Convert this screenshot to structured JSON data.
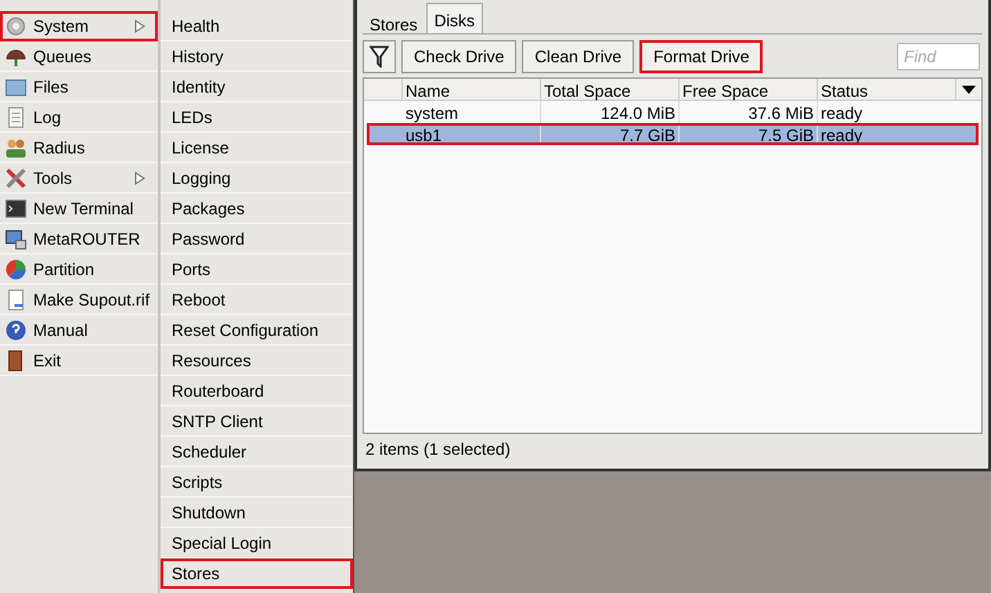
{
  "menu": {
    "items": [
      {
        "label": "System",
        "submenu": true,
        "outlined": true
      },
      {
        "label": "Queues",
        "submenu": false,
        "outlined": false
      },
      {
        "label": "Files",
        "submenu": false,
        "outlined": false
      },
      {
        "label": "Log",
        "submenu": false,
        "outlined": false
      },
      {
        "label": "Radius",
        "submenu": false,
        "outlined": false
      },
      {
        "label": "Tools",
        "submenu": true,
        "outlined": false
      },
      {
        "label": "New Terminal",
        "submenu": false,
        "outlined": false
      },
      {
        "label": "MetaROUTER",
        "submenu": false,
        "outlined": false
      },
      {
        "label": "Partition",
        "submenu": false,
        "outlined": false
      },
      {
        "label": "Make Supout.rif",
        "submenu": false,
        "outlined": false
      },
      {
        "label": "Manual",
        "submenu": false,
        "outlined": false
      },
      {
        "label": "Exit",
        "submenu": false,
        "outlined": false
      }
    ]
  },
  "submenu": {
    "items": [
      {
        "label": "Health",
        "outlined": false
      },
      {
        "label": "History",
        "outlined": false
      },
      {
        "label": "Identity",
        "outlined": false
      },
      {
        "label": "LEDs",
        "outlined": false
      },
      {
        "label": "License",
        "outlined": false
      },
      {
        "label": "Logging",
        "outlined": false
      },
      {
        "label": "Packages",
        "outlined": false
      },
      {
        "label": "Password",
        "outlined": false
      },
      {
        "label": "Ports",
        "outlined": false
      },
      {
        "label": "Reboot",
        "outlined": false
      },
      {
        "label": "Reset Configuration",
        "outlined": false
      },
      {
        "label": "Resources",
        "outlined": false
      },
      {
        "label": "Routerboard",
        "outlined": false
      },
      {
        "label": "SNTP Client",
        "outlined": false
      },
      {
        "label": "Scheduler",
        "outlined": false
      },
      {
        "label": "Scripts",
        "outlined": false
      },
      {
        "label": "Shutdown",
        "outlined": false
      },
      {
        "label": "Special Login",
        "outlined": false
      },
      {
        "label": "Stores",
        "outlined": true
      }
    ]
  },
  "window": {
    "tabs": [
      {
        "label": "Stores",
        "selected": false
      },
      {
        "label": "Disks",
        "selected": true
      }
    ],
    "buttons": [
      {
        "label": "Check Drive",
        "outlined": false
      },
      {
        "label": "Clean Drive",
        "outlined": false
      },
      {
        "label": "Format Drive",
        "outlined": true
      }
    ],
    "search": {
      "placeholder": "Find"
    },
    "table": {
      "columns": [
        "Name",
        "Total Space",
        "Free Space",
        "Status"
      ],
      "rows": [
        {
          "cells": [
            "system",
            "124.0 MiB",
            "37.6 MiB",
            "ready"
          ],
          "selected": false,
          "outlined": false
        },
        {
          "cells": [
            "usb1",
            "7.7 GiB",
            "7.5 GiB",
            "ready"
          ],
          "selected": true,
          "outlined": true
        }
      ]
    },
    "status_bar": "2 items (1 selected)"
  }
}
